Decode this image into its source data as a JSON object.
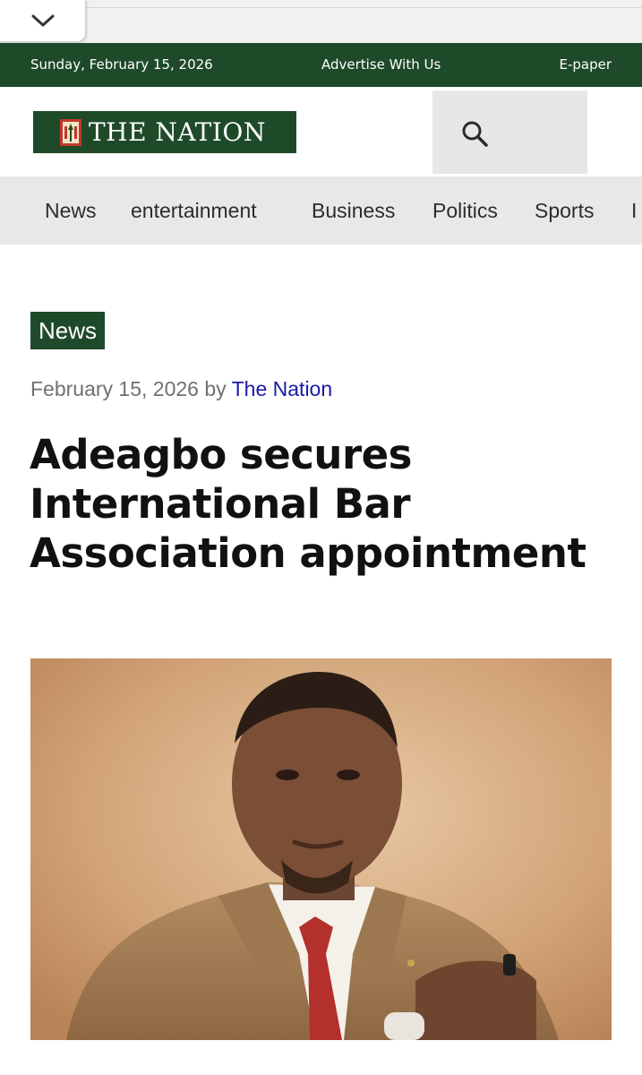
{
  "browser": {
    "collapse_icon": "chevron-down-icon"
  },
  "topbar": {
    "date": "Sunday, February 15, 2026",
    "advertise": "Advertise With Us",
    "epaper": "E-paper",
    "background": "#1f4a29"
  },
  "header": {
    "logo_text": "THE NATION",
    "search_icon": "search-icon"
  },
  "nav": {
    "items": [
      {
        "label": "News"
      },
      {
        "label": "entertainment"
      },
      {
        "label": "Business"
      },
      {
        "label": "Politics"
      },
      {
        "label": "Sports"
      },
      {
        "label": "I"
      }
    ]
  },
  "article": {
    "category": "News",
    "date": "February 15, 2026",
    "by": "by",
    "author": "The Nation",
    "title": "Adeagbo secures International Bar Association appointment",
    "author_color": "#1a19a7"
  },
  "colors": {
    "brand_green": "#1f4a29",
    "nav_background": "#e8e8e8"
  }
}
